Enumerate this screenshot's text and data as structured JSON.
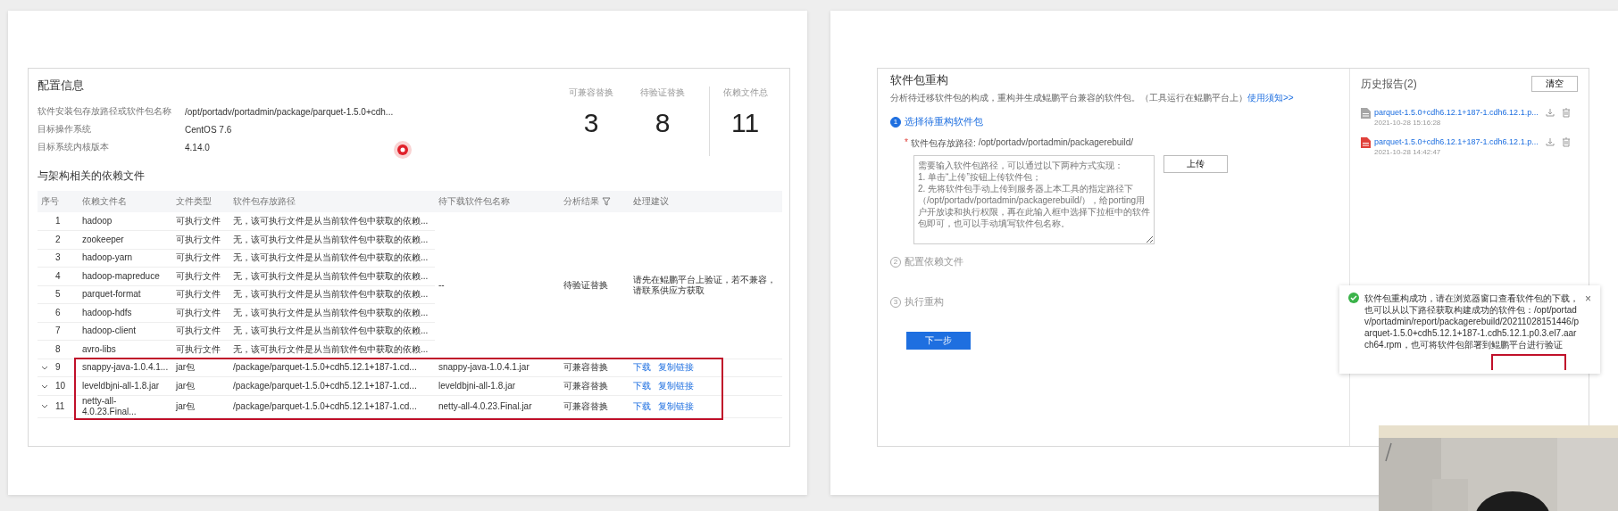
{
  "left_slide": {
    "config": {
      "title": "配置信息",
      "fields": [
        {
          "label": "软件安装包存放路径或软件包名称",
          "value": "/opt/portadv/portadmin/package/parquet-1.5.0+cdh..."
        },
        {
          "label": "目标操作系统",
          "value": "CentOS 7.6"
        },
        {
          "label": "目标系统内核版本",
          "value": "4.14.0"
        }
      ],
      "stats": [
        {
          "label": "可兼容替换",
          "value": "3"
        },
        {
          "label": "待验证替换",
          "value": "8"
        },
        {
          "label": "依赖文件总",
          "value": "11"
        }
      ]
    },
    "dependencies": {
      "title": "与架构相关的依赖文件",
      "columns": [
        {
          "label": "序号",
          "filter": false
        },
        {
          "label": "依赖文件名",
          "filter": false
        },
        {
          "label": "文件类型",
          "filter": false
        },
        {
          "label": "软件包存放路径",
          "filter": false
        },
        {
          "label": "待下载软件包名称",
          "filter": false
        },
        {
          "label": "分析结果",
          "filter": true
        },
        {
          "label": "处理建议",
          "filter": false
        }
      ],
      "groups": [
        {
          "download_name": "--",
          "result": "待验证替换",
          "advice": "请先在鲲鹏平台上验证，若不兼容，请联系供应方获取",
          "highlighted": false,
          "rows": [
            {
              "index": "1",
              "name": "hadoop",
              "type": "可执行文件",
              "path": "无，该可执行文件是从当前软件包中获取的依赖...",
              "expandable": false
            },
            {
              "index": "2",
              "name": "zookeeper",
              "type": "可执行文件",
              "path": "无，该可执行文件是从当前软件包中获取的依赖...",
              "expandable": false
            },
            {
              "index": "3",
              "name": "hadoop-yarn",
              "type": "可执行文件",
              "path": "无，该可执行文件是从当前软件包中获取的依赖...",
              "expandable": false
            },
            {
              "index": "4",
              "name": "hadoop-mapreduce",
              "type": "可执行文件",
              "path": "无，该可执行文件是从当前软件包中获取的依赖...",
              "expandable": false
            },
            {
              "index": "5",
              "name": "parquet-format",
              "type": "可执行文件",
              "path": "无，该可执行文件是从当前软件包中获取的依赖...",
              "expandable": false
            },
            {
              "index": "6",
              "name": "hadoop-hdfs",
              "type": "可执行文件",
              "path": "无，该可执行文件是从当前软件包中获取的依赖...",
              "expandable": false
            },
            {
              "index": "7",
              "name": "hadoop-client",
              "type": "可执行文件",
              "path": "无，该可执行文件是从当前软件包中获取的依赖...",
              "expandable": false
            },
            {
              "index": "8",
              "name": "avro-libs",
              "type": "可执行文件",
              "path": "无，该可执行文件是从当前软件包中获取的依赖...",
              "expandable": false
            }
          ]
        },
        {
          "download_name": "snappy-java-1.0.4.1.jar",
          "result": "可兼容替换",
          "actions": [
            "下载",
            "复制链接"
          ],
          "highlighted": true,
          "rows": [
            {
              "index": "9",
              "name": "snappy-java-1.0.4.1...",
              "type": "jar包",
              "path": "/package/parquet-1.5.0+cdh5.12.1+187-1.cd...",
              "expandable": true
            }
          ]
        },
        {
          "download_name": "leveldbjni-all-1.8.jar",
          "result": "可兼容替换",
          "actions": [
            "下载",
            "复制链接"
          ],
          "highlighted": true,
          "rows": [
            {
              "index": "10",
              "name": "leveldbjni-all-1.8.jar",
              "type": "jar包",
              "path": "/package/parquet-1.5.0+cdh5.12.1+187-1.cd...",
              "expandable": true
            }
          ]
        },
        {
          "download_name": "netty-all-4.0.23.Final.jar",
          "result": "可兼容替换",
          "actions": [
            "下载",
            "复制链接"
          ],
          "highlighted": true,
          "rows": [
            {
              "index": "11",
              "name": "netty-all-4.0.23.Final...",
              "type": "jar包",
              "path": "/package/parquet-1.5.0+cdh5.12.1+187-1.cd...",
              "expandable": true
            }
          ]
        }
      ]
    }
  },
  "right_slide": {
    "rebuild": {
      "title": "软件包重构",
      "description": "分析待迁移软件包的构成，重构并生成鲲鹏平台兼容的软件包。（工具运行在鲲鹏平台上）",
      "help_link": "使用须知>>",
      "steps": [
        {
          "number": "1",
          "label": "选择待重构软件包",
          "active": true
        },
        {
          "number": "2",
          "label": "配置依赖文件",
          "active": false
        },
        {
          "number": "3",
          "label": "执行重构",
          "active": false
        }
      ],
      "required_mark": "*",
      "path_label": "软件包存放路径:",
      "path_value": "/opt/portadv/portadmin/packagerebuild/",
      "package_field": {
        "placeholder": "需要输入软件包路径，可以通过以下两种方式实现：\n1. 单击“上传”按钮上传软件包；\n2. 先将软件包手动上传到服务器上本工具的指定路径下（/opt/portadv/portadmin/packagerebuild/），给porting用户开放读和执行权限，再在此输入框中选择下拉框中的软件包即可，也可以手动填写软件包名称。"
      },
      "upload_button": "上传",
      "next_button": "下一步"
    },
    "history": {
      "title": "历史报告(2)",
      "clear_button": "清空",
      "reports": [
        {
          "name": "parquet-1.5.0+cdh6.12.1+187-1.cdh6.12.1.p...",
          "time": "2021-10-28 15:16:28",
          "color": "#a6a6a6"
        },
        {
          "name": "parquet-1.5.0+cdh6.12.1+187-1.cdh6.12.1.p...",
          "time": "2021-10-28 14:42:47",
          "color": "#e0413a"
        }
      ]
    },
    "toast": {
      "message": "软件包重构成功，请在浏览器窗口查看软件包的下载，也可以从以下路径获取构建成功的软件包：/opt/portadv/portadmin/report/packagerebuild/20211028151446/parquet-1.5.0+cdh5.12.1+187-1.cdh5.12.1.p0.3.el7.aarch64.rpm，也可将软件包部署到鲲鹏平台进行验证",
      "close": "×"
    }
  }
}
